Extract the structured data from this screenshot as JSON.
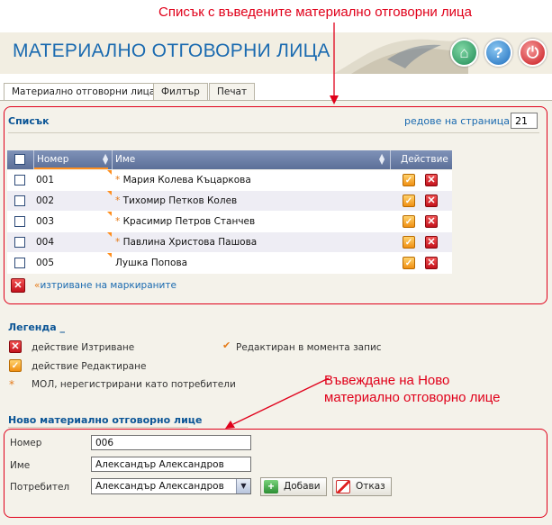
{
  "annotations": {
    "list_note": "Списък с въведените материално отговорни лица",
    "new_note_line1": "Въвеждане на Ново",
    "new_note_line2": "материално отговорно лице"
  },
  "header": {
    "title": "МАТЕРИАЛНО ОТГОВОРНИ ЛИЦА",
    "icons": [
      "home-icon",
      "help-icon",
      "power-icon"
    ]
  },
  "tabs": [
    {
      "label": "Материално отговорни лица",
      "active": true
    },
    {
      "label": "Филтър",
      "active": false
    },
    {
      "label": "Печат",
      "active": false
    }
  ],
  "list": {
    "title": "Списък",
    "rows_per_page_label": "редове на страница",
    "rows_per_page_value": "21",
    "columns": {
      "number": "Номер",
      "name": "Име",
      "action": "Действие"
    },
    "rows": [
      {
        "number": "001",
        "name": "Мария Колева Къцаркова",
        "star": "*"
      },
      {
        "number": "002",
        "name": "Тихомир Петков Колев",
        "star": "*"
      },
      {
        "number": "003",
        "name": "Красимир Петров Станчев",
        "star": "*"
      },
      {
        "number": "004",
        "name": "Павлина Христова Пашова",
        "star": "*"
      },
      {
        "number": "005",
        "name": "Лушка Попова",
        "star": ""
      }
    ],
    "delete_marked": "изтриване на маркираните",
    "raquo": "«",
    "raquo_right": "»"
  },
  "legend": {
    "title": "Легенда _",
    "delete": "действие Изтриване",
    "edit": "действие Редактиране",
    "star": "*",
    "unregistered": "МОЛ, нерегистрирани като потребители",
    "edited_now": "Редактиран в момента запис"
  },
  "new_form": {
    "title": "Ново материално отговорно лице",
    "number_label": "Номер",
    "number_value": "006",
    "name_label": "Име",
    "name_value": "Александър Александров",
    "user_label": "Потребител",
    "user_value": "Александър Александров",
    "add_label": "Добави",
    "cancel_label": "Отказ"
  },
  "colors": {
    "accent_blue": "#0b5596",
    "header_bar": "#5c6f98",
    "annotation_red": "#e0001a",
    "marker_orange": "#ff8f1f"
  }
}
